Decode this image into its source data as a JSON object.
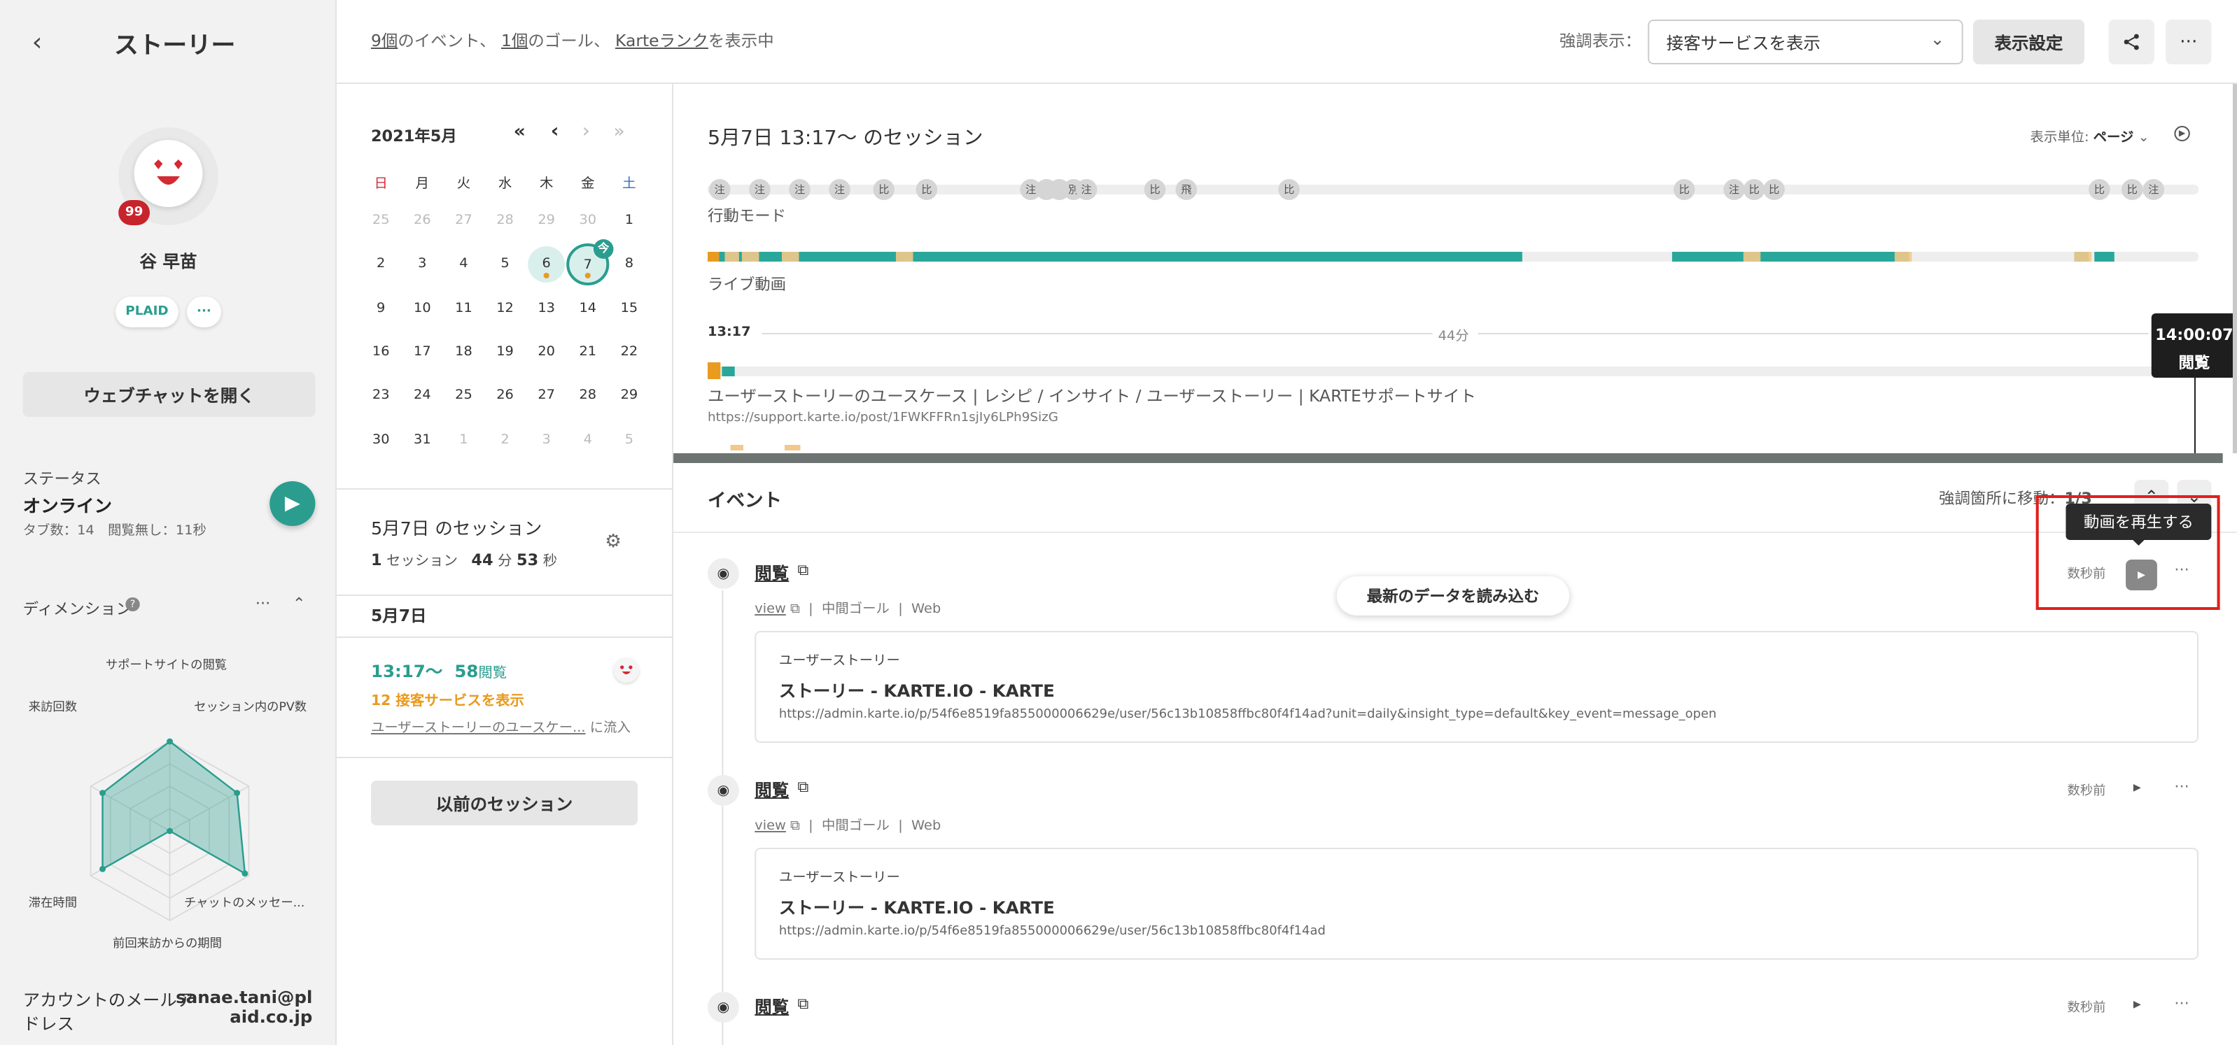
{
  "sidebar": {
    "title": "ストーリー",
    "badge": "99",
    "user_name": "谷 早苗",
    "org_chip": "PLAID",
    "more_chip": "···",
    "webchat_button": "ウェブチャットを開く",
    "status_label": "ステータス",
    "status_value": "オンライン",
    "tab_info": "タブ数：14　閲覧無し：11秒",
    "dimension_label": "ディメンション",
    "dimension_more": "···",
    "radar": {
      "axes": [
        "サポートサイトの閲覧",
        "セッション内のPV数",
        "チャットのメッセー...",
        "前回来訪からの期間",
        "滞在時間",
        "来訪回数"
      ],
      "values": [
        1.0,
        0.85,
        0.95,
        0.0,
        0.85,
        0.85
      ]
    },
    "account_email_label_1": "アカウントのメールア",
    "account_email_label_2": "ドレス",
    "account_email_value_1": "sanae.tani@pl",
    "account_email_value_2": "aid.co.jp"
  },
  "topbar": {
    "sum_events_count": "9個",
    "sum_events_text": "のイベント、",
    "sum_goal_count": "1個",
    "sum_goal_text": "のゴール、",
    "sum_rank": "Karteランク",
    "sum_rank_text": "を表示中",
    "highlight_label": "強調表示：",
    "highlight_select": "接客サービスを表示",
    "display_settings": "表示設定"
  },
  "calendar": {
    "month": "2021年5月",
    "nav": [
      "«",
      "‹",
      "›",
      "»"
    ],
    "weekdays": [
      "日",
      "月",
      "火",
      "水",
      "木",
      "金",
      "土"
    ],
    "weeks": [
      [
        "25",
        "26",
        "27",
        "28",
        "29",
        "30",
        "1"
      ],
      [
        "2",
        "3",
        "4",
        "5",
        "6",
        "7",
        "8"
      ],
      [
        "9",
        "10",
        "11",
        "12",
        "13",
        "14",
        "15"
      ],
      [
        "16",
        "17",
        "18",
        "19",
        "20",
        "21",
        "22"
      ],
      [
        "23",
        "24",
        "25",
        "26",
        "27",
        "28",
        "29"
      ],
      [
        "30",
        "31",
        "1",
        "2",
        "3",
        "4",
        "5"
      ]
    ],
    "today_badge": "今",
    "session_day_title": "5月7日 のセッション",
    "session_count": "1",
    "session_unit": "セッション",
    "session_min": "44",
    "session_min_unit": "分",
    "session_sec": "53",
    "session_sec_unit": "秒",
    "date_header": "5月7日",
    "entry_time": "13:17〜",
    "entry_views_num": "58",
    "entry_views": "閲覧",
    "entry_service_num": "12",
    "entry_service": "接客サービスを表示",
    "entry_inflow_link": "ユーザーストーリーのユースケー...",
    "entry_inflow": "に流入",
    "prev_sessions": "以前のセッション"
  },
  "session": {
    "title": "5月7日 13:17〜 のセッション",
    "unit_label": "表示単位:",
    "unit_value": "ページ",
    "markers": [
      "注",
      "注",
      "注",
      "注",
      "比",
      "比",
      "注",
      "",
      "",
      "別",
      "注",
      "比",
      "飛",
      "比",
      "比",
      "注",
      "比",
      "比",
      "比",
      "比",
      "注"
    ],
    "mode_label": "行動モード",
    "live_label": "ライブ動画",
    "time_start": "13:17",
    "duration": "44分",
    "page_title": "ユーザーストーリーのユースケース | レシピ / インサイト / ユーザーストーリー | KARTEサポートサイト",
    "page_url": "https://support.karte.io/post/1FWKFFRn1sjIy6LPh9SizG",
    "cursor_time": "14:00:07",
    "cursor_label": "閲覧"
  },
  "events": {
    "heading": "イベント",
    "jump_label": "強調箇所に移動：",
    "jump_count": "1/3",
    "reload_button": "最新のデータを読み込む",
    "tooltip": "動画を再生する",
    "items": [
      {
        "title": "閲覧",
        "view": "view",
        "goal": "中間ゴール",
        "channel": "Web",
        "time": "数秒前",
        "card_label": "ユーザーストーリー",
        "card_title": "ストーリー - KARTE.IO - KARTE",
        "card_url": "https://admin.karte.io/p/54f6e8519fa855000006629e/user/56c13b10858ffbc80f4f14ad?unit=daily&insight_type=default&key_event=message_open"
      },
      {
        "title": "閲覧",
        "view": "view",
        "goal": "中間ゴール",
        "channel": "Web",
        "time": "数秒前",
        "card_label": "ユーザーストーリー",
        "card_title": "ストーリー - KARTE.IO - KARTE",
        "card_url": "https://admin.karte.io/p/54f6e8519fa855000006629e/user/56c13b10858ffbc80f4f14ad"
      },
      {
        "title": "閲覧",
        "time": "数秒前"
      }
    ]
  },
  "colors": {
    "accent": "#2a9d8f",
    "highlight_orange": "#e99b1f",
    "highlight_box": "#e0201c"
  }
}
